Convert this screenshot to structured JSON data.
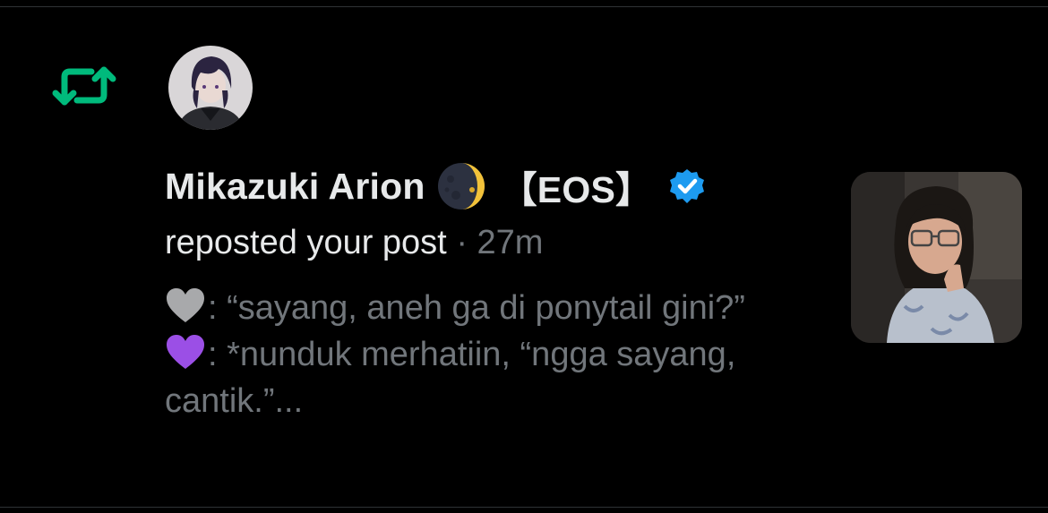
{
  "notification": {
    "icon": "repost-icon",
    "user_name": "Mikazuki Arion",
    "name_emoji": "🌘",
    "name_tag": "【EOS】",
    "verified_icon": "verified-badge-icon",
    "action_text": "reposted your post",
    "separator": "·",
    "time_ago": "27m",
    "lines": [
      {
        "emoji": "grey-heart",
        "text": ": “sayang, aneh ga di ponytail gini?”"
      },
      {
        "emoji": "purple-heart",
        "text": ": *nunduk merhatiin, “ngga sayang, cantik.”..."
      }
    ]
  },
  "colors": {
    "background": "#000000",
    "repost_green": "#00ba7c",
    "verified_blue": "#1d9bf0",
    "muted_text": "#71767b",
    "primary_text": "#e7e9ea"
  }
}
